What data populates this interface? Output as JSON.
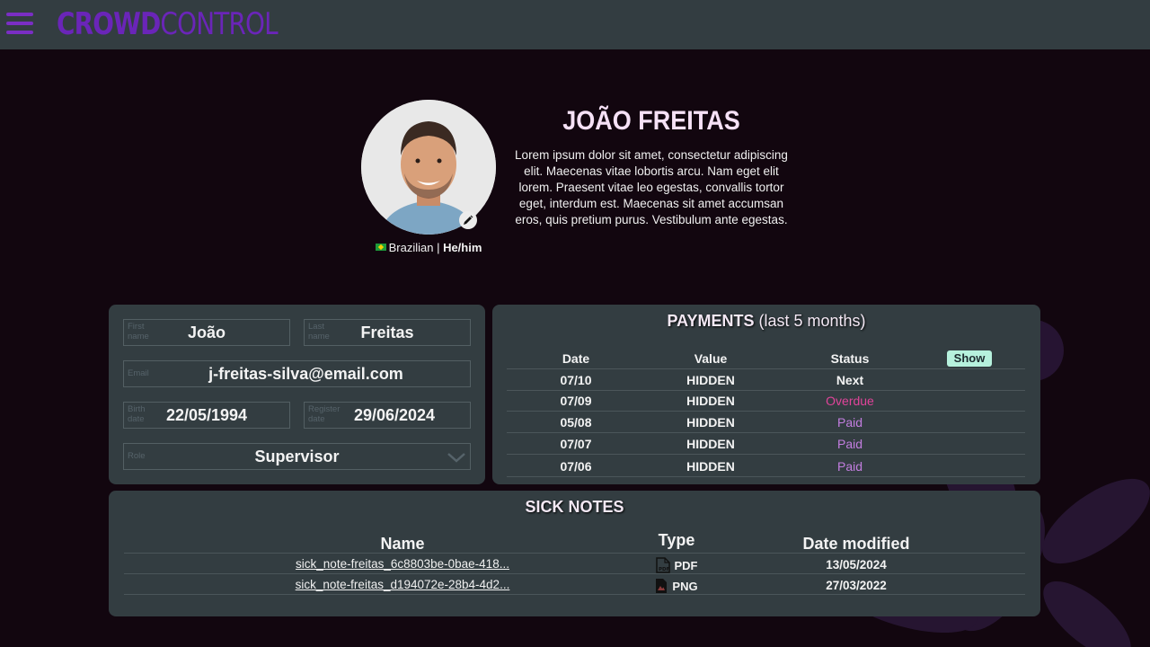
{
  "header": {
    "logo_part1": "CROWD",
    "logo_part2": "CONTROL",
    "menu_icon": "hamburger-menu-icon"
  },
  "profile": {
    "name": "JOÃO FREITAS",
    "bio": "Lorem ipsum dolor sit amet, consectetur adipiscing elit. Maecenas vitae  lobortis arcu. Nam eget elit lorem. Praesent vitae leo egestas,  convallis tortor eget, interdum est. Maecenas sit amet accumsan eros,  quis pretium purus. Vestibulum ante egestas.",
    "nationality": "Brazilian",
    "separator": " | ",
    "pronouns": "He/him",
    "edit_icon": "pencil-icon"
  },
  "form": {
    "first_name": {
      "label": "First name",
      "value": "João"
    },
    "last_name": {
      "label": "Last name",
      "value": "Freitas"
    },
    "email": {
      "label": "Email",
      "value": "j-freitas-silva@email.com"
    },
    "birth_date": {
      "label": "Birth date",
      "value": "22/05/1994"
    },
    "register_date": {
      "label": "Register date",
      "value": "29/06/2024"
    },
    "role": {
      "label": "Role",
      "value": "Supervisor"
    }
  },
  "payments": {
    "title_bold": "PAYMENTS",
    "title_rest": " (last 5 months)",
    "headers": {
      "date": "Date",
      "value": "Value",
      "status": "Status"
    },
    "show_label": "Show",
    "rows": [
      {
        "date": "07/10",
        "value": "HIDDEN",
        "status": "Next",
        "status_color": "#f3f3f3"
      },
      {
        "date": "07/09",
        "value": "HIDDEN",
        "status": "Overdue",
        "status_color": "#e0449a"
      },
      {
        "date": "05/08",
        "value": "HIDDEN",
        "status": "Paid",
        "status_color": "#c37ee0"
      },
      {
        "date": "07/07",
        "value": "HIDDEN",
        "status": "Paid",
        "status_color": "#c37ee0"
      },
      {
        "date": "07/06",
        "value": "HIDDEN",
        "status": "Paid",
        "status_color": "#c37ee0"
      }
    ]
  },
  "sick_notes": {
    "title": "SICK NOTES",
    "headers": {
      "name": "Name",
      "type": "Type",
      "date": "Date modified"
    },
    "rows": [
      {
        "name": "sick_note-freitas_6c8803be-0bae-418...",
        "type": "PDF",
        "type_icon": "pdf-file-icon",
        "date": "13/05/2024"
      },
      {
        "name": "sick_note-freitas_d194072e-28b4-4d2...",
        "type": "PNG",
        "type_icon": "png-file-icon",
        "date": "27/03/2022"
      }
    ]
  },
  "colors": {
    "background": "#12060f",
    "panel": "#333d41",
    "brand_purple": "#6a25b8",
    "overdue": "#e0449a",
    "paid": "#c37ee0",
    "show_button": "#b6f1dd"
  }
}
